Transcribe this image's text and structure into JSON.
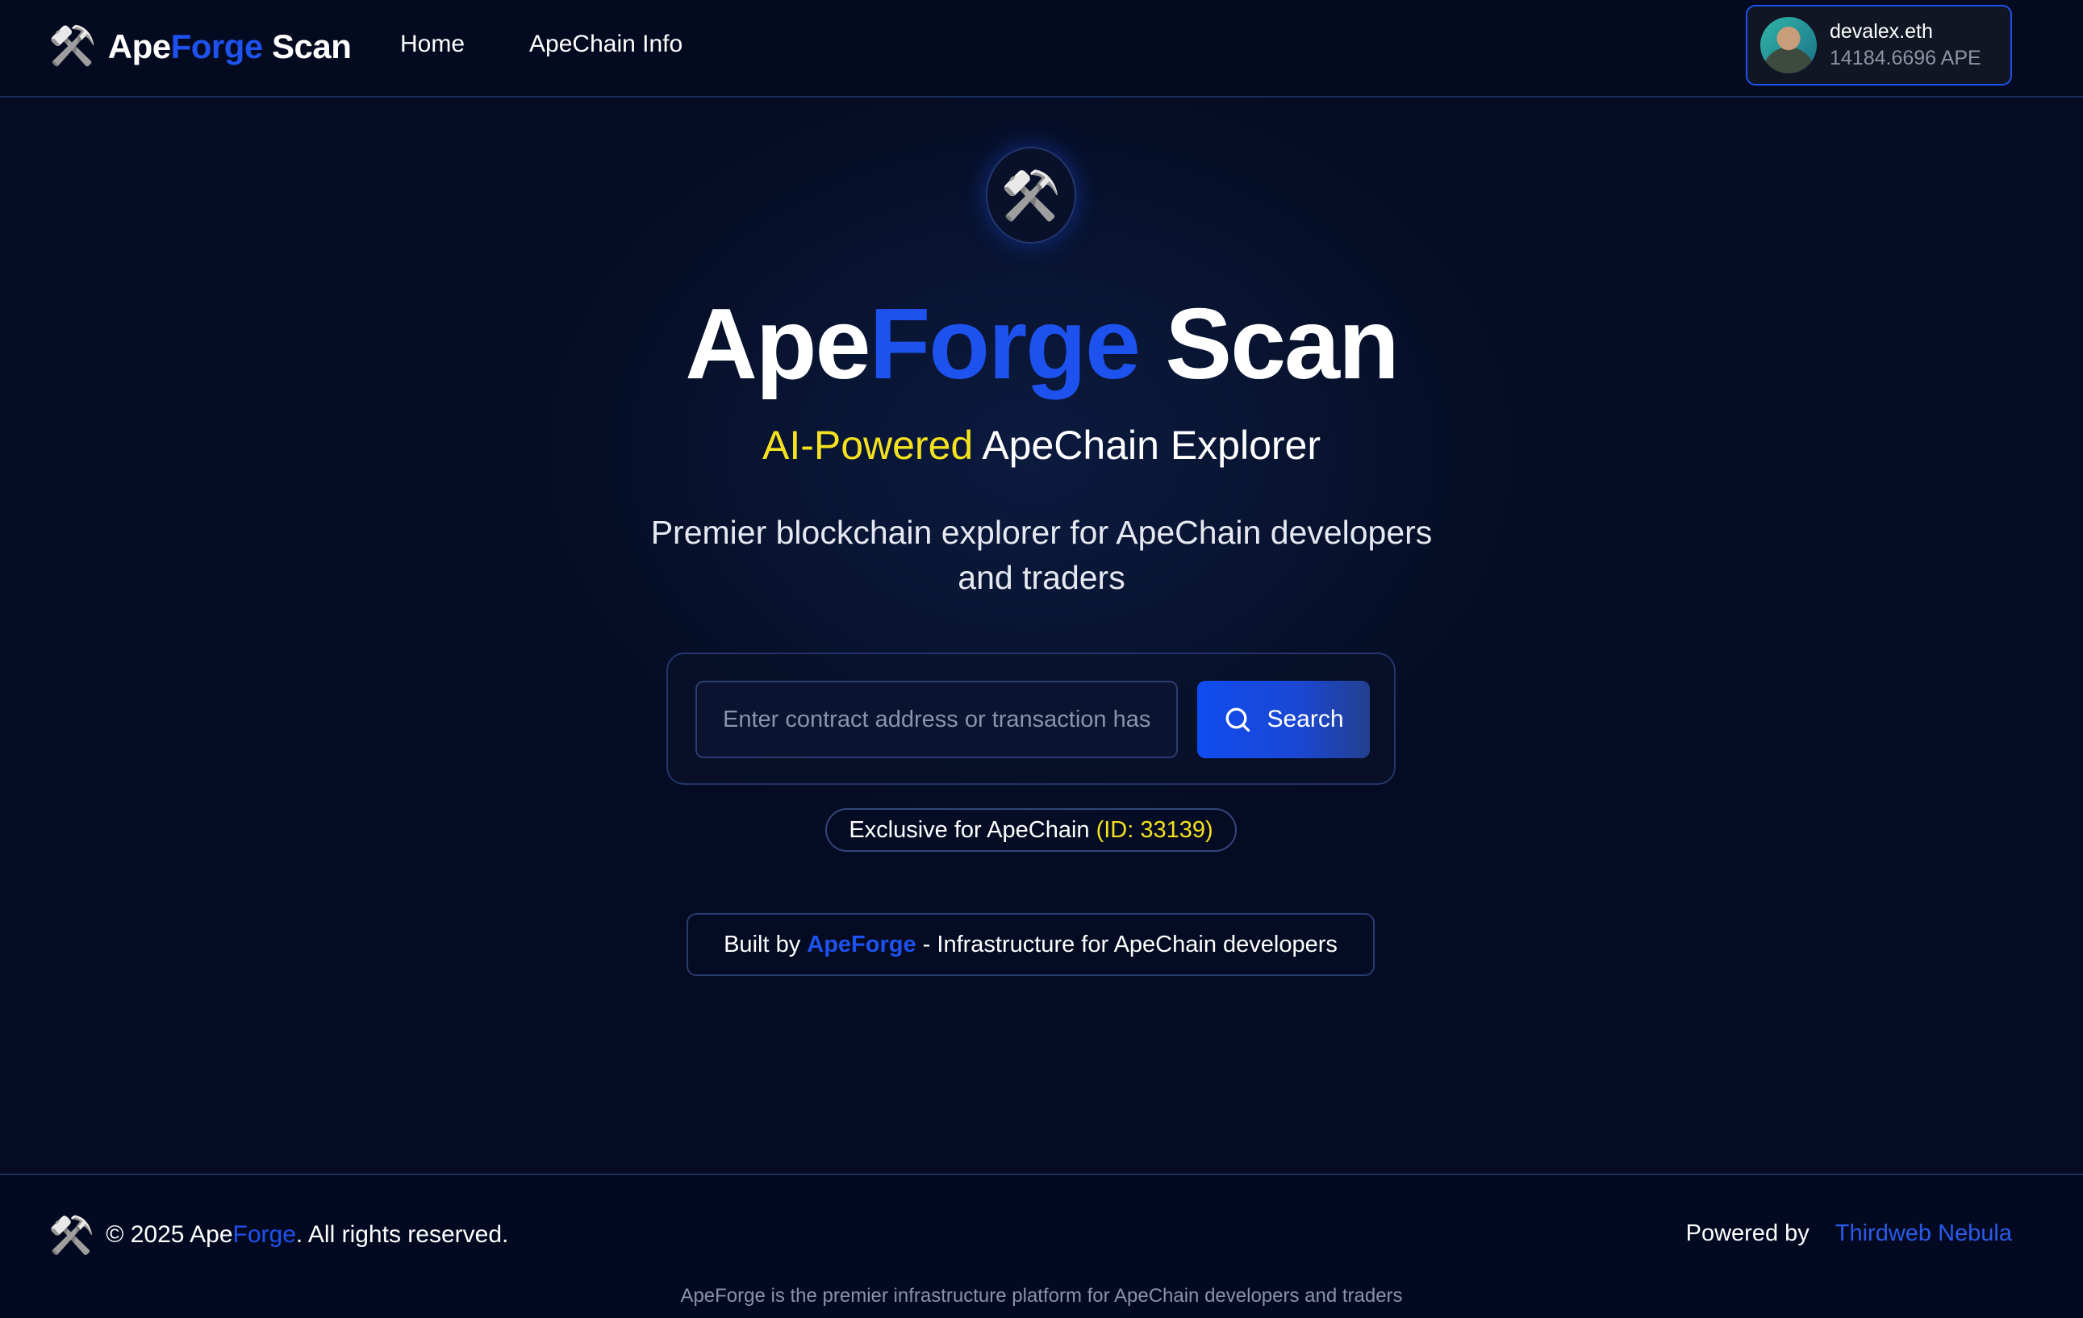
{
  "header": {
    "brand": {
      "icon": "hammer-pick-icon",
      "part1": "Ape",
      "part2": "Forge",
      "part3": " Scan"
    },
    "nav": [
      {
        "label": "Home"
      },
      {
        "label": "ApeChain Info"
      }
    ],
    "wallet": {
      "name": "devalex.eth",
      "balance": "14184.6696 APE"
    }
  },
  "hero": {
    "logo_icon": "hammer-pick-icon",
    "title": {
      "part1": "Ape",
      "part2": "Forge",
      "part3": " Scan"
    },
    "subtitle": {
      "highlight": "AI-Powered",
      "rest": " ApeChain Explorer"
    },
    "description": "Premier blockchain explorer for ApeChain developers and traders"
  },
  "search": {
    "placeholder": "Enter contract address or transaction hash",
    "value": "",
    "button_label": "Search"
  },
  "chain_badge": {
    "text": "Exclusive for ApeChain ",
    "id_text": "(ID: 33139)"
  },
  "built_by": {
    "prefix": "Built by ",
    "link": "ApeForge",
    "suffix": " - Infrastructure for ApeChain developers"
  },
  "footer": {
    "copyright_prefix": "© 2025 Ape",
    "copyright_highlight": "Forge",
    "copyright_suffix": ". All rights reserved.",
    "powered_label": "Powered by",
    "powered_link": "Thirdweb Nebula",
    "note": "ApeForge is the premier infrastructure platform for ApeChain developers and traders"
  },
  "colors": {
    "accent_blue": "#1d52ee",
    "accent_yellow": "#f4e21f",
    "background": "#050b22"
  }
}
